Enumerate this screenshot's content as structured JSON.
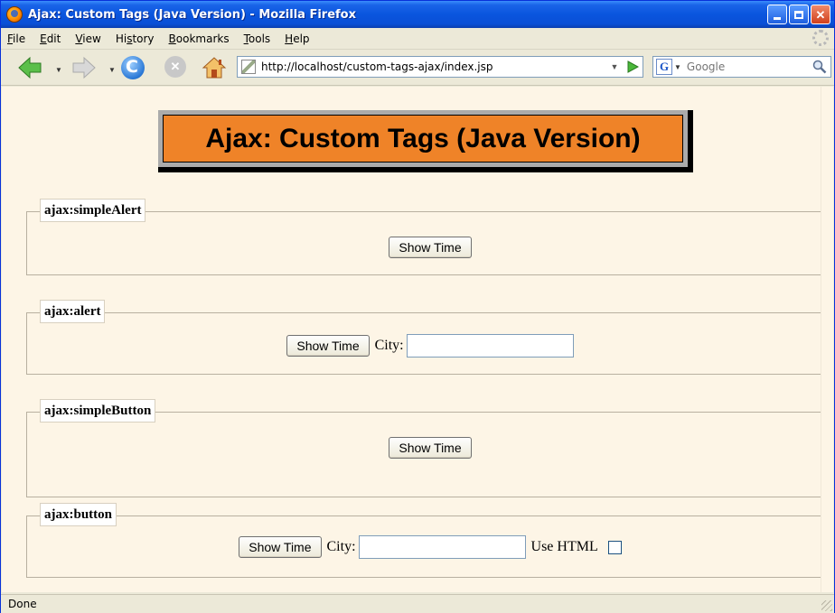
{
  "window": {
    "title": "Ajax: Custom Tags (Java Version) - Mozilla Firefox"
  },
  "menu": [
    {
      "label": "File",
      "accel": "F",
      "rest": "ile"
    },
    {
      "label": "Edit",
      "accel": "E",
      "rest": "dit"
    },
    {
      "label": "View",
      "accel": "V",
      "rest": "iew"
    },
    {
      "label": "History",
      "accel": "s",
      "pre": "Hi",
      "rest": "tory"
    },
    {
      "label": "Bookmarks",
      "accel": "B",
      "rest": "ookmarks"
    },
    {
      "label": "Tools",
      "accel": "T",
      "rest": "ools"
    },
    {
      "label": "Help",
      "accel": "H",
      "rest": "elp"
    }
  ],
  "nav": {
    "url": "http://localhost/custom-tags-ajax/index.jsp",
    "search_placeholder": "Google"
  },
  "page": {
    "heading": "Ajax: Custom Tags (Java Version)",
    "sections": [
      {
        "legend": "ajax:simpleAlert",
        "button": "Show Time"
      },
      {
        "legend": "ajax:alert",
        "button": "Show Time",
        "city_label": "City:"
      },
      {
        "legend": "ajax:simpleButton",
        "button": "Show Time"
      },
      {
        "legend": "ajax:button",
        "button": "Show Time",
        "city_label": "City:",
        "html_label": "Use HTML"
      }
    ]
  },
  "status": {
    "text": "Done"
  }
}
